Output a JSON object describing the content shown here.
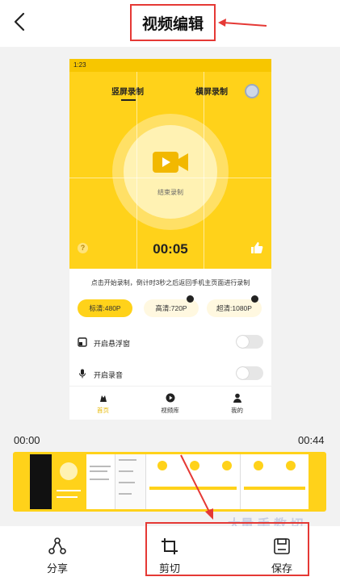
{
  "header": {
    "title": "视频编辑",
    "back_icon": "chevron-left-icon"
  },
  "preview": {
    "status_time": "1:23",
    "tabs": [
      "竖屏录制",
      "横屏录制"
    ],
    "stop_label": "结束录制",
    "timer": "00:05",
    "help_glyph": "?",
    "tip": "点击开始录制，倒计时3秒之后返回手机主页面进行录制",
    "quality_options": [
      "标清:480P",
      "高清:720P",
      "超清:1080P"
    ],
    "rows": [
      "开启悬浮窗",
      "开启录音"
    ],
    "nav": [
      "首页",
      "视频库",
      "我的"
    ]
  },
  "timeline": {
    "start_time": "00:00",
    "end_time": "00:44"
  },
  "watermark": "大量 手 教 切",
  "toolbar": {
    "share_label": "分享",
    "crop_label": "剪切",
    "save_label": "保存"
  },
  "colors": {
    "accent_yellow": "#ffd21a",
    "annotation_red": "#e53935"
  }
}
